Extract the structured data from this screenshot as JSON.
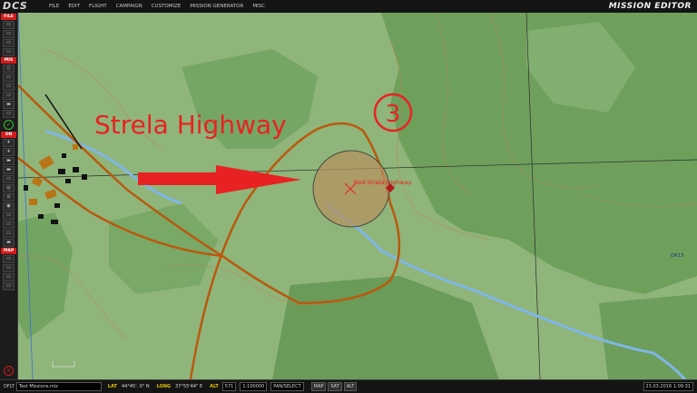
{
  "app": {
    "logo": "DCS",
    "title": "MISSION EDITOR"
  },
  "menu": [
    "FILE",
    "EDIT",
    "FLIGHT",
    "CAMPAIGN",
    "CUSTOMIZE",
    "MISSION GENERATOR",
    "MISC"
  ],
  "sidebar": {
    "sections": {
      "file": "FILE",
      "mis": "MIS",
      "on": "ON",
      "map": "MAP"
    },
    "file_buttons": [
      "▭",
      "▭",
      "▭",
      "▭"
    ],
    "mis_buttons": [
      "▯",
      "▭",
      "▭",
      "▭",
      "▬",
      "▭",
      "✓"
    ],
    "on_buttons": [
      "✈",
      "✈",
      "▬",
      "▬",
      "▭",
      "◎",
      "⊙",
      "◉",
      "▭",
      "▭",
      "▭",
      "▬"
    ],
    "map_buttons": [
      "▭",
      "▭",
      "▭",
      "▭"
    ],
    "check_icon": "check-circle-icon",
    "bottom_icon": "close-circle-icon"
  },
  "map": {
    "annotation_title": "Strela Highway",
    "waypoint_number": "3",
    "zone_label": "Red Strela Highway",
    "grid_label": "DK15",
    "colors": {
      "annotation": "#e82222",
      "road": "#b85a0e",
      "river": "#7fb6e6",
      "zone_fill": "#b5915f"
    }
  },
  "status": {
    "mode": "DFLT",
    "mission_file": "Test Missions.miz",
    "lat_label": "LAT",
    "lat_value": "44°45'. 0\" N",
    "long_label": "LONG",
    "long_value": "37°55'44\" E",
    "alt_label": "ALT",
    "alt_value": "571",
    "scale": "1:100000",
    "pan_select": "PAN/SELECT",
    "map_btn": "MAP",
    "sat_btn": "SAT",
    "alt_btn": "ALT",
    "datetime": "23.03.2016 1:09:31"
  }
}
